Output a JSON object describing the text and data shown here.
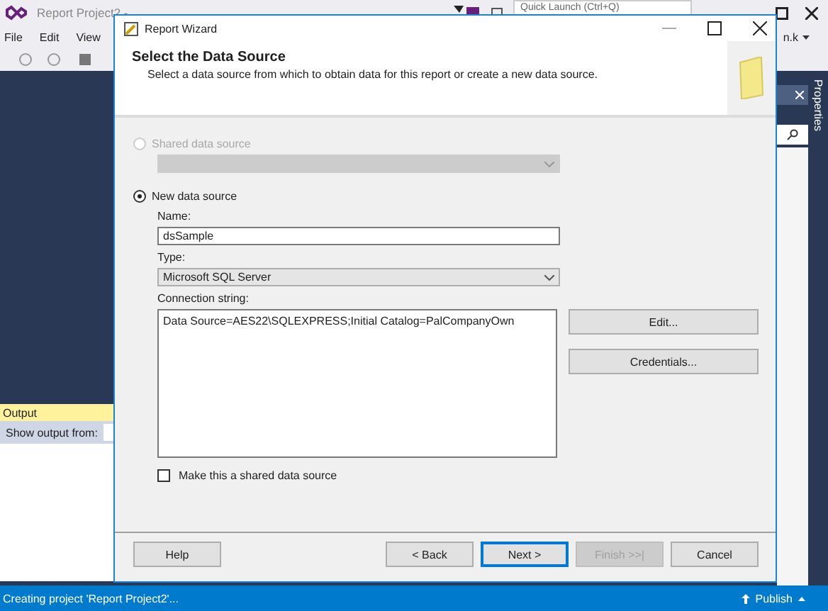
{
  "ide": {
    "title": "Report Project2 -",
    "menu": [
      "File",
      "Edit",
      "View"
    ],
    "quick_launch": {
      "placeholder": "Quick Launch (Ctrl+Q)"
    },
    "user": "n.k",
    "side_tab": "Properties",
    "output": {
      "title": "Output",
      "show_from": "Show output from:"
    },
    "status": {
      "text": "Creating project 'Report Project2'...",
      "publish": "Publish"
    }
  },
  "dialog": {
    "title": "Report Wizard",
    "heading": "Select the Data Source",
    "subheading": "Select a data source from which to obtain data for this report or create a new data source.",
    "options": [
      {
        "label": "Shared data source",
        "selected": false,
        "disabled": true
      },
      {
        "label": "New data source",
        "selected": true,
        "disabled": false
      }
    ],
    "name_label": "Name:",
    "name_value": "dsSample",
    "type_label": "Type:",
    "type_value": "Microsoft SQL Server",
    "conn_label": "Connection string:",
    "conn_value": "Data Source=AES22\\SQLEXPRESS;Initial Catalog=PalCompanyOwn",
    "side_buttons": [
      "Edit...",
      "Credentials..."
    ],
    "shared_checkbox": {
      "label": "Make this a shared data source",
      "checked": false
    },
    "help_button": "Help",
    "buttons": [
      {
        "label": "< Back",
        "disabled": false,
        "default": false
      },
      {
        "label": "Next >",
        "disabled": false,
        "default": true
      },
      {
        "label": "Finish >>|",
        "disabled": true,
        "default": false
      },
      {
        "label": "Cancel",
        "disabled": false,
        "default": false
      }
    ]
  }
}
